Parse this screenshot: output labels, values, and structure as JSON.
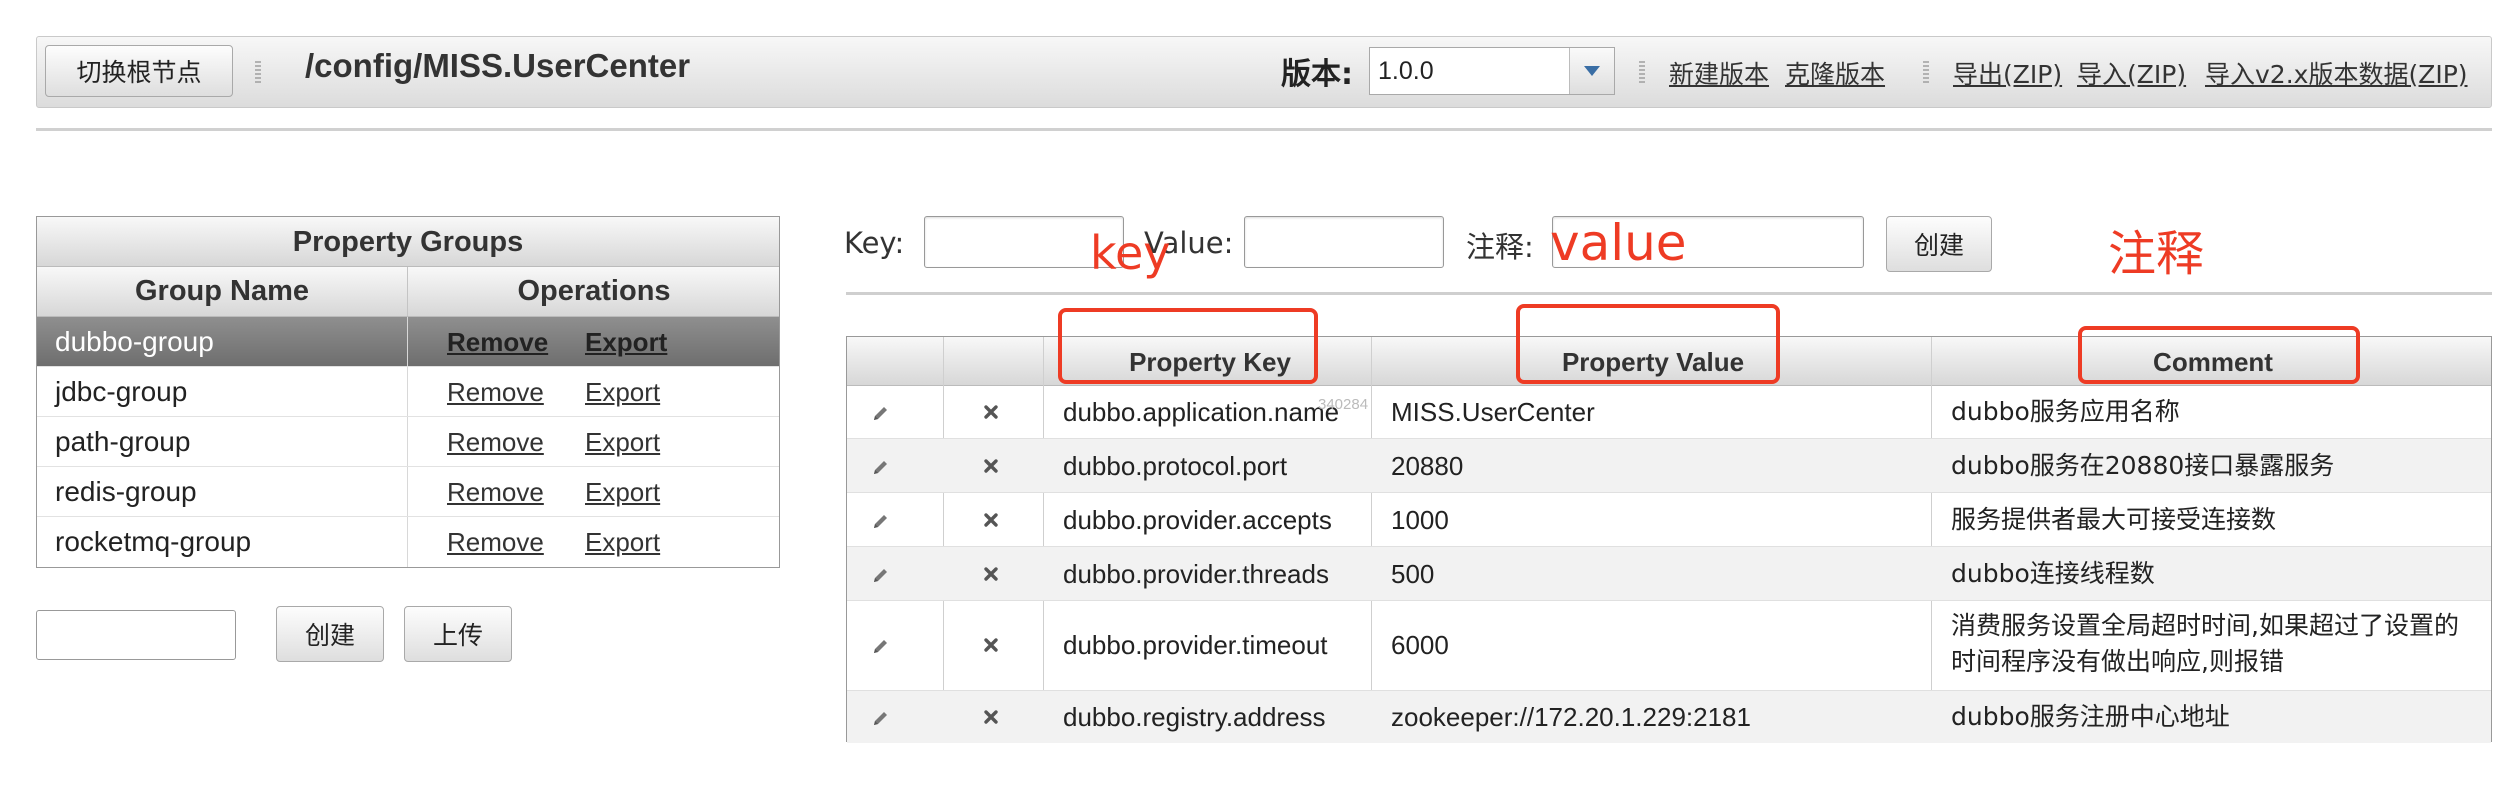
{
  "toolbar": {
    "switch_root_label": "切换根节点",
    "path": "/config/MISS.UserCenter",
    "version_label": "版本:",
    "version_value": "1.0.0",
    "links": [
      "新建版本",
      "克隆版本",
      "导出(ZIP)",
      "导入(ZIP)",
      "导入v2.x版本数据(ZIP)"
    ]
  },
  "groups": {
    "title": "Property Groups",
    "columns": [
      "Group Name",
      "Operations"
    ],
    "remove_label": "Remove",
    "export_label": "Export",
    "items": [
      "dubbo-group",
      "jdbc-group",
      "path-group",
      "redis-group",
      "rocketmq-group"
    ],
    "selected": "dubbo-group",
    "create_label": "创建",
    "upload_label": "上传"
  },
  "form": {
    "key_label": "Key:",
    "value_label": "Value:",
    "comment_label": "注释:",
    "create_label": "创建"
  },
  "props": {
    "columns": [
      "Property Key",
      "Property Value",
      "Comment"
    ],
    "rows": [
      {
        "key": "dubbo.application.name",
        "value": "MISS.UserCenter",
        "comment": "dubbo服务应用名称"
      },
      {
        "key": "dubbo.protocol.port",
        "value": "20880",
        "comment": "dubbo服务在20880接口暴露服务"
      },
      {
        "key": "dubbo.provider.accepts",
        "value": "1000",
        "comment": "服务提供者最大可接受连接数"
      },
      {
        "key": "dubbo.provider.threads",
        "value": "500",
        "comment": "dubbo连接线程数"
      },
      {
        "key": "dubbo.provider.timeout",
        "value": "6000",
        "comment": "消费服务设置全局超时时间,如果超过了设置的时间程序没有做出响应,则报错"
      },
      {
        "key": "dubbo.registry.address",
        "value": "zookeeper://172.20.1.229:2181",
        "comment": "dubbo服务注册中心地址"
      }
    ]
  },
  "annotations": {
    "key": "key",
    "value": "value",
    "comment": "注释",
    "color": "#ee3b24"
  },
  "watermark": "340284"
}
